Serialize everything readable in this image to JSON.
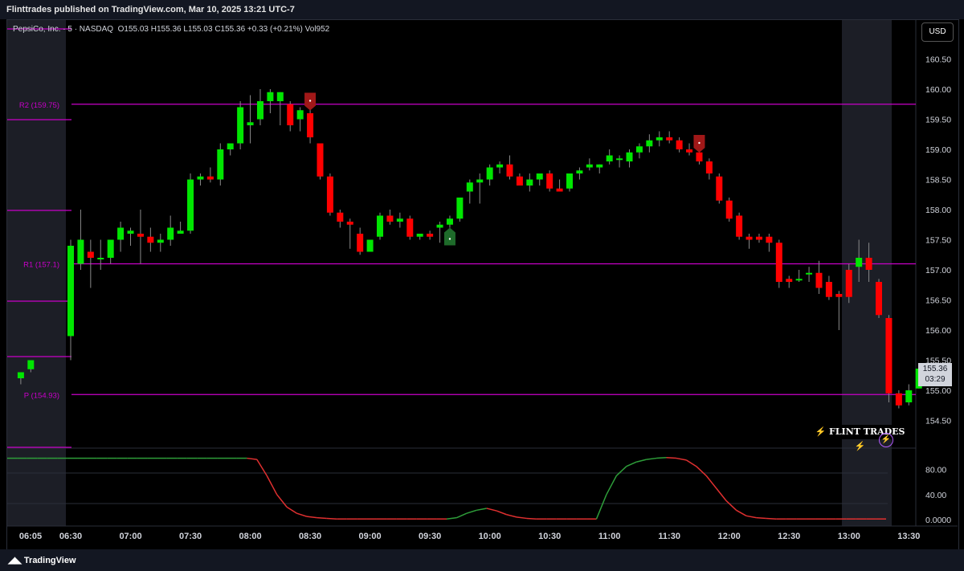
{
  "header": {
    "publish_text": "Flinttrades published on TradingView.com, Mar 10, 2025 13:21 UTC-7"
  },
  "legend": {
    "symbol": "PepsiCo, Inc. · 5 · NASDAQ",
    "open_label": "O",
    "open": "155.03",
    "high_label": "H",
    "high": "155.36",
    "low_label": "L",
    "low": "155.03",
    "close_label": "C",
    "close": "155.36",
    "change": "+0.33 (+0.21%)",
    "vol_label": "Vol",
    "volume": "952"
  },
  "currency_button": "USD",
  "last_price": {
    "price": "155.36",
    "countdown": "03:29"
  },
  "pivot_labels": {
    "r2": "R2 (159.75)",
    "r1": "R1 (157.1)",
    "p": "P (154.93)"
  },
  "watermark": {
    "text": "FLINT TRADES",
    "bolt": "⚡"
  },
  "footer": {
    "brand": "TradingView",
    "logo_icon": "tradingview-logo-icon"
  },
  "colors": {
    "up": "#00e600",
    "down": "#ff0000",
    "pivot": "#c800c8",
    "osc_up": "#2e9e3a",
    "osc_down": "#e03030",
    "session": "#1c1e26"
  },
  "chart_data": {
    "type": "candlestick",
    "symbol": "PepsiCo, Inc.",
    "interval": "5",
    "exchange": "NASDAQ",
    "price_axis": {
      "ylim": [
        154.2,
        160.8
      ],
      "ticks": [
        "160.50",
        "160.00",
        "159.50",
        "159.00",
        "158.50",
        "158.00",
        "157.50",
        "157.00",
        "156.50",
        "156.00",
        "155.50",
        "155.00",
        "154.50"
      ]
    },
    "time_axis": {
      "ticks": [
        "06:05",
        "06:30",
        "07:00",
        "07:30",
        "08:00",
        "08:30",
        "09:00",
        "09:30",
        "10:00",
        "10:30",
        "11:00",
        "11:30",
        "12:00",
        "12:30",
        "13:00",
        "13:30"
      ]
    },
    "pivot_levels": [
      {
        "label": "R2 (159.75)",
        "value": 159.75
      },
      {
        "label": "R1 (157.1)",
        "value": 157.1
      },
      {
        "label": "P (154.93)",
        "value": 154.93
      }
    ],
    "candles": [
      {
        "t": "06:05",
        "o": 155.2,
        "h": 155.3,
        "l": 155.1,
        "c": 155.3
      },
      {
        "t": "06:10",
        "o": 155.35,
        "h": 155.5,
        "l": 155.3,
        "c": 155.5
      },
      {
        "t": "06:30",
        "o": 155.9,
        "h": 157.5,
        "l": 155.5,
        "c": 157.4
      },
      {
        "t": "06:35",
        "o": 157.1,
        "h": 158.0,
        "l": 157.0,
        "c": 157.5
      },
      {
        "t": "06:40",
        "o": 157.3,
        "h": 157.5,
        "l": 156.7,
        "c": 157.2
      },
      {
        "t": "06:45",
        "o": 157.2,
        "h": 157.5,
        "l": 157.0,
        "c": 157.2
      },
      {
        "t": "06:50",
        "o": 157.2,
        "h": 157.5,
        "l": 157.1,
        "c": 157.5
      },
      {
        "t": "06:55",
        "o": 157.5,
        "h": 157.8,
        "l": 157.3,
        "c": 157.7
      },
      {
        "t": "07:00",
        "o": 157.6,
        "h": 157.7,
        "l": 157.4,
        "c": 157.65
      },
      {
        "t": "07:05",
        "o": 157.6,
        "h": 158.0,
        "l": 157.1,
        "c": 157.55
      },
      {
        "t": "07:10",
        "o": 157.55,
        "h": 157.7,
        "l": 157.3,
        "c": 157.45
      },
      {
        "t": "07:15",
        "o": 157.45,
        "h": 157.6,
        "l": 157.3,
        "c": 157.5
      },
      {
        "t": "07:20",
        "o": 157.5,
        "h": 157.9,
        "l": 157.4,
        "c": 157.7
      },
      {
        "t": "07:25",
        "o": 157.6,
        "h": 157.8,
        "l": 157.6,
        "c": 157.65
      },
      {
        "t": "07:30",
        "o": 157.65,
        "h": 158.6,
        "l": 157.6,
        "c": 158.5
      },
      {
        "t": "07:35",
        "o": 158.5,
        "h": 158.6,
        "l": 158.4,
        "c": 158.55
      },
      {
        "t": "07:40",
        "o": 158.55,
        "h": 158.7,
        "l": 158.45,
        "c": 158.5
      },
      {
        "t": "07:45",
        "o": 158.5,
        "h": 159.1,
        "l": 158.4,
        "c": 159.0
      },
      {
        "t": "07:50",
        "o": 159.0,
        "h": 159.1,
        "l": 158.9,
        "c": 159.1
      },
      {
        "t": "07:55",
        "o": 159.1,
        "h": 159.8,
        "l": 159.0,
        "c": 159.7
      },
      {
        "t": "08:00",
        "o": 159.4,
        "h": 159.9,
        "l": 159.1,
        "c": 159.45
      },
      {
        "t": "08:05",
        "o": 159.5,
        "h": 160.0,
        "l": 159.4,
        "c": 159.8
      },
      {
        "t": "08:10",
        "o": 159.8,
        "h": 160.0,
        "l": 159.6,
        "c": 159.95
      },
      {
        "t": "08:15",
        "o": 159.8,
        "h": 159.95,
        "l": 159.4,
        "c": 159.95
      },
      {
        "t": "08:20",
        "o": 159.75,
        "h": 159.8,
        "l": 159.3,
        "c": 159.4
      },
      {
        "t": "08:25",
        "o": 159.5,
        "h": 159.7,
        "l": 159.3,
        "c": 159.65
      },
      {
        "t": "08:30",
        "o": 159.6,
        "h": 159.7,
        "l": 159.1,
        "c": 159.2
      },
      {
        "t": "08:35",
        "o": 159.1,
        "h": 159.1,
        "l": 158.5,
        "c": 158.55
      },
      {
        "t": "08:40",
        "o": 158.55,
        "h": 158.6,
        "l": 157.9,
        "c": 157.95
      },
      {
        "t": "08:45",
        "o": 157.95,
        "h": 158.0,
        "l": 157.7,
        "c": 157.8
      },
      {
        "t": "08:50",
        "o": 157.8,
        "h": 157.85,
        "l": 157.35,
        "c": 157.75
      },
      {
        "t": "08:55",
        "o": 157.6,
        "h": 157.7,
        "l": 157.25,
        "c": 157.3
      },
      {
        "t": "09:00",
        "o": 157.3,
        "h": 157.5,
        "l": 157.3,
        "c": 157.5
      },
      {
        "t": "09:05",
        "o": 157.55,
        "h": 157.95,
        "l": 157.5,
        "c": 157.9
      },
      {
        "t": "09:10",
        "o": 157.9,
        "h": 158.0,
        "l": 157.75,
        "c": 157.8
      },
      {
        "t": "09:15",
        "o": 157.8,
        "h": 157.95,
        "l": 157.7,
        "c": 157.85
      },
      {
        "t": "09:20",
        "o": 157.85,
        "h": 157.9,
        "l": 157.5,
        "c": 157.55
      },
      {
        "t": "09:25",
        "o": 157.55,
        "h": 157.6,
        "l": 157.5,
        "c": 157.6
      },
      {
        "t": "09:30",
        "o": 157.6,
        "h": 157.65,
        "l": 157.5,
        "c": 157.55
      },
      {
        "t": "09:35",
        "o": 157.7,
        "h": 157.8,
        "l": 157.45,
        "c": 157.75
      },
      {
        "t": "09:40",
        "o": 157.75,
        "h": 157.9,
        "l": 157.7,
        "c": 157.85
      },
      {
        "t": "09:45",
        "o": 157.85,
        "h": 158.2,
        "l": 157.8,
        "c": 158.2
      },
      {
        "t": "09:50",
        "o": 158.3,
        "h": 158.5,
        "l": 158.1,
        "c": 158.45
      },
      {
        "t": "09:55",
        "o": 158.45,
        "h": 158.6,
        "l": 158.1,
        "c": 158.5
      },
      {
        "t": "10:00",
        "o": 158.5,
        "h": 158.75,
        "l": 158.4,
        "c": 158.7
      },
      {
        "t": "10:05",
        "o": 158.7,
        "h": 158.8,
        "l": 158.6,
        "c": 158.75
      },
      {
        "t": "10:10",
        "o": 158.75,
        "h": 158.9,
        "l": 158.5,
        "c": 158.55
      },
      {
        "t": "10:15",
        "o": 158.55,
        "h": 158.6,
        "l": 158.4,
        "c": 158.4
      },
      {
        "t": "10:20",
        "o": 158.4,
        "h": 158.6,
        "l": 158.3,
        "c": 158.5
      },
      {
        "t": "10:25",
        "o": 158.5,
        "h": 158.6,
        "l": 158.4,
        "c": 158.6
      },
      {
        "t": "10:30",
        "o": 158.6,
        "h": 158.65,
        "l": 158.3,
        "c": 158.35
      },
      {
        "t": "10:35",
        "o": 158.35,
        "h": 158.5,
        "l": 158.3,
        "c": 158.3
      },
      {
        "t": "10:40",
        "o": 158.35,
        "h": 158.6,
        "l": 158.3,
        "c": 158.6
      },
      {
        "t": "10:45",
        "o": 158.6,
        "h": 158.7,
        "l": 158.5,
        "c": 158.65
      },
      {
        "t": "10:50",
        "o": 158.7,
        "h": 158.85,
        "l": 158.65,
        "c": 158.75
      },
      {
        "t": "10:55",
        "o": 158.7,
        "h": 158.75,
        "l": 158.6,
        "c": 158.75
      },
      {
        "t": "11:00",
        "o": 158.8,
        "h": 159.0,
        "l": 158.75,
        "c": 158.9
      },
      {
        "t": "11:05",
        "o": 158.85,
        "h": 158.9,
        "l": 158.7,
        "c": 158.85
      },
      {
        "t": "11:10",
        "o": 158.8,
        "h": 159.0,
        "l": 158.7,
        "c": 158.95
      },
      {
        "t": "11:15",
        "o": 158.95,
        "h": 159.1,
        "l": 158.85,
        "c": 159.05
      },
      {
        "t": "11:20",
        "o": 159.05,
        "h": 159.25,
        "l": 158.95,
        "c": 159.15
      },
      {
        "t": "11:25",
        "o": 159.15,
        "h": 159.3,
        "l": 159.05,
        "c": 159.2
      },
      {
        "t": "11:30",
        "o": 159.2,
        "h": 159.3,
        "l": 159.1,
        "c": 159.15
      },
      {
        "t": "11:35",
        "o": 159.15,
        "h": 159.2,
        "l": 158.95,
        "c": 159.0
      },
      {
        "t": "11:40",
        "o": 159.0,
        "h": 159.1,
        "l": 158.9,
        "c": 158.95
      },
      {
        "t": "11:45",
        "o": 158.95,
        "h": 159.0,
        "l": 158.75,
        "c": 158.8
      },
      {
        "t": "11:50",
        "o": 158.8,
        "h": 158.85,
        "l": 158.5,
        "c": 158.6
      },
      {
        "t": "11:55",
        "o": 158.55,
        "h": 158.6,
        "l": 158.1,
        "c": 158.15
      },
      {
        "t": "12:00",
        "o": 158.15,
        "h": 158.2,
        "l": 157.8,
        "c": 157.85
      },
      {
        "t": "12:05",
        "o": 157.9,
        "h": 157.95,
        "l": 157.5,
        "c": 157.55
      },
      {
        "t": "12:10",
        "o": 157.55,
        "h": 157.6,
        "l": 157.35,
        "c": 157.5
      },
      {
        "t": "12:15",
        "o": 157.55,
        "h": 157.6,
        "l": 157.45,
        "c": 157.5
      },
      {
        "t": "12:20",
        "o": 157.55,
        "h": 157.6,
        "l": 157.3,
        "c": 157.45
      },
      {
        "t": "12:25",
        "o": 157.45,
        "h": 157.5,
        "l": 156.7,
        "c": 156.8
      },
      {
        "t": "12:30",
        "o": 156.85,
        "h": 156.9,
        "l": 156.7,
        "c": 156.8
      },
      {
        "t": "12:35",
        "o": 156.85,
        "h": 157.0,
        "l": 156.8,
        "c": 156.85
      },
      {
        "t": "12:40",
        "o": 156.95,
        "h": 157.05,
        "l": 156.8,
        "c": 156.95
      },
      {
        "t": "12:45",
        "o": 156.95,
        "h": 157.15,
        "l": 156.6,
        "c": 156.7
      },
      {
        "t": "12:50",
        "o": 156.8,
        "h": 156.9,
        "l": 156.5,
        "c": 156.55
      },
      {
        "t": "12:55",
        "o": 156.6,
        "h": 156.65,
        "l": 156.0,
        "c": 156.55
      },
      {
        "t": "13:00",
        "o": 157.0,
        "h": 157.1,
        "l": 156.45,
        "c": 156.55
      },
      {
        "t": "13:05",
        "o": 157.05,
        "h": 157.5,
        "l": 156.8,
        "c": 157.2
      },
      {
        "t": "13:10",
        "o": 157.2,
        "h": 157.45,
        "l": 156.8,
        "c": 157.0
      },
      {
        "t": "13:15",
        "o": 156.8,
        "h": 156.85,
        "l": 156.2,
        "c": 156.25
      },
      {
        "t": "13:20",
        "o": 156.2,
        "h": 156.25,
        "l": 154.8,
        "c": 154.95
      },
      {
        "t": "13:25",
        "o": 154.95,
        "h": 155.0,
        "l": 154.7,
        "c": 154.75
      },
      {
        "t": "13:30",
        "o": 154.8,
        "h": 155.1,
        "l": 154.75,
        "c": 155.0
      },
      {
        "t": "13:35",
        "o": 155.03,
        "h": 155.36,
        "l": 155.03,
        "c": 155.36
      }
    ],
    "signals": [
      {
        "t": "08:30",
        "type": "sell"
      },
      {
        "t": "09:40",
        "type": "buy"
      },
      {
        "t": "11:45",
        "type": "sell"
      }
    ],
    "oscillator": {
      "ylim": [
        0,
        100
      ],
      "ticks": [
        "80.00",
        "40.00",
        "0.0000"
      ],
      "values": [
        98,
        98,
        98,
        98,
        98,
        98,
        98,
        98,
        98,
        98,
        98,
        98,
        98,
        98,
        98,
        98,
        98,
        98,
        98,
        98,
        98,
        98,
        98,
        98,
        98,
        96,
        70,
        40,
        20,
        10,
        5,
        3,
        2,
        1,
        1,
        1,
        1,
        1,
        1,
        1,
        1,
        1,
        1,
        1,
        1,
        3,
        10,
        15,
        18,
        14,
        8,
        4,
        2,
        1,
        1,
        1,
        1,
        1,
        1,
        1,
        40,
        70,
        85,
        92,
        96,
        98,
        99,
        98,
        95,
        85,
        70,
        50,
        30,
        15,
        6,
        3,
        2,
        1,
        1,
        1,
        1,
        1,
        1,
        1,
        1,
        1,
        1,
        1,
        1
      ]
    }
  }
}
